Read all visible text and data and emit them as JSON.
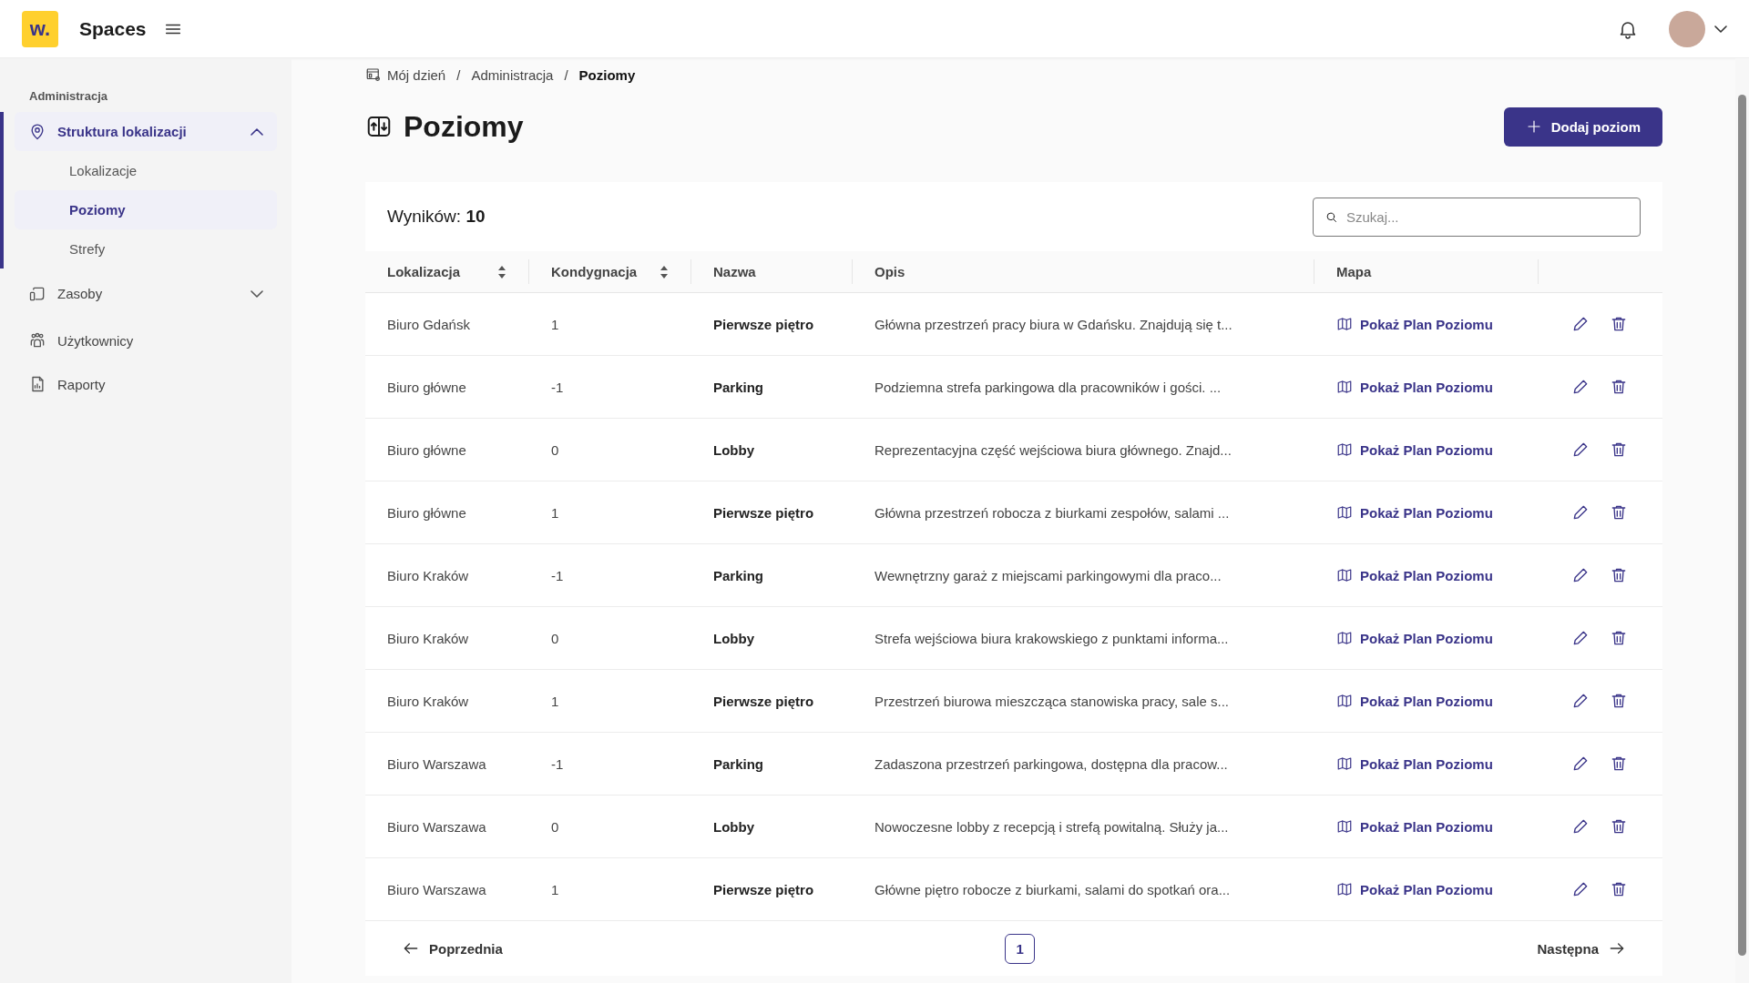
{
  "header": {
    "logo_text": "w.",
    "app_name": "Spaces"
  },
  "sidebar": {
    "section_label": "Administracja",
    "items": [
      {
        "label": "Struktura lokalizacji",
        "selected": true,
        "expanded": true,
        "children": [
          {
            "label": "Lokalizacje",
            "selected": false
          },
          {
            "label": "Poziomy",
            "selected": true
          },
          {
            "label": "Strefy",
            "selected": false
          }
        ]
      },
      {
        "label": "Zasoby",
        "selected": false,
        "expanded": false
      },
      {
        "label": "Użytkownicy",
        "selected": false
      },
      {
        "label": "Raporty",
        "selected": false
      }
    ]
  },
  "breadcrumb": {
    "separator": "/",
    "items": [
      "Mój dzień",
      "Administracja",
      "Poziomy"
    ]
  },
  "page_title": "Poziomy",
  "add_button": "Dodaj poziom",
  "table": {
    "results_label": "Wyników:",
    "results_count": "10",
    "search": {
      "placeholder": "Szukaj..."
    },
    "columns": [
      {
        "label": "Lokalizacja",
        "sortable": true
      },
      {
        "label": "Kondygnacja",
        "sortable": true
      },
      {
        "label": "Nazwa",
        "sortable": false
      },
      {
        "label": "Opis",
        "sortable": false
      },
      {
        "label": "Mapa",
        "sortable": false
      }
    ],
    "rows": [
      {
        "location": "Biuro Gdańsk",
        "floor": "1",
        "name": "Pierwsze piętro",
        "description": "Główna przestrzeń pracy biura w Gdańsku. Znajdują się t...",
        "map_link": "Pokaż Plan Poziomu"
      },
      {
        "location": "Biuro główne",
        "floor": "-1",
        "name": "Parking",
        "description": "Podziemna strefa parkingowa dla pracowników i gości. ...",
        "map_link": "Pokaż Plan Poziomu"
      },
      {
        "location": "Biuro główne",
        "floor": "0",
        "name": "Lobby",
        "description": "Reprezentacyjna część wejściowa biura głównego. Znajd...",
        "map_link": "Pokaż Plan Poziomu"
      },
      {
        "location": "Biuro główne",
        "floor": "1",
        "name": "Pierwsze piętro",
        "description": "Główna przestrzeń robocza z biurkami zespołów, salami ...",
        "map_link": "Pokaż Plan Poziomu"
      },
      {
        "location": "Biuro Kraków",
        "floor": "-1",
        "name": "Parking",
        "description": "Wewnętrzny garaż z miejscami parkingowymi dla praco...",
        "map_link": "Pokaż Plan Poziomu"
      },
      {
        "location": "Biuro Kraków",
        "floor": "0",
        "name": "Lobby",
        "description": "Strefa wejściowa biura krakowskiego z punktami informa...",
        "map_link": "Pokaż Plan Poziomu"
      },
      {
        "location": "Biuro Kraków",
        "floor": "1",
        "name": "Pierwsze piętro",
        "description": "Przestrzeń biurowa mieszcząca stanowiska pracy, sale s...",
        "map_link": "Pokaż Plan Poziomu"
      },
      {
        "location": "Biuro Warszawa",
        "floor": "-1",
        "name": "Parking",
        "description": "Zadaszona przestrzeń parkingowa, dostępna dla pracow...",
        "map_link": "Pokaż Plan Poziomu"
      },
      {
        "location": "Biuro Warszawa",
        "floor": "0",
        "name": "Lobby",
        "description": "Nowoczesne lobby z recepcją i strefą powitalną. Służy ja...",
        "map_link": "Pokaż Plan Poziomu"
      },
      {
        "location": "Biuro Warszawa",
        "floor": "1",
        "name": "Pierwsze piętro",
        "description": "Główne piętro robocze z biurkami, salami do spotkań ora...",
        "map_link": "Pokaż Plan Poziomu"
      }
    ]
  },
  "pagination": {
    "previous": "Poprzednia",
    "pages": [
      {
        "label": "1",
        "selected": true
      }
    ],
    "next": "Następna"
  }
}
